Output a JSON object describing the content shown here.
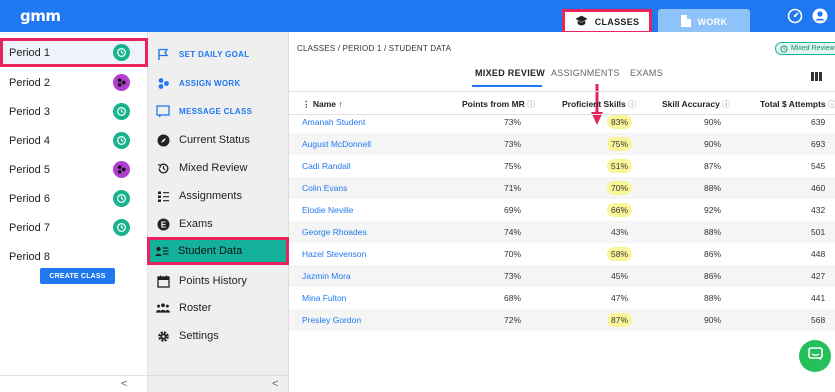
{
  "app": {
    "logo": "gmm"
  },
  "topbar": {
    "tabs": [
      {
        "label": "CLASSES",
        "icon": "graduation-cap-icon",
        "active": true
      },
      {
        "label": "WORK",
        "icon": "document-icon",
        "active": false
      }
    ],
    "icons": [
      "speedometer-icon",
      "account-circle-icon"
    ]
  },
  "periods": {
    "items": [
      {
        "label": "Period 1",
        "badge": "green",
        "active": true
      },
      {
        "label": "Period 2",
        "badge": "purple",
        "active": false
      },
      {
        "label": "Period 3",
        "badge": "green",
        "active": false
      },
      {
        "label": "Period 4",
        "badge": "green",
        "active": false
      },
      {
        "label": "Period 5",
        "badge": "purple",
        "active": false
      },
      {
        "label": "Period 6",
        "badge": "green",
        "active": false
      },
      {
        "label": "Period 7",
        "badge": "green",
        "active": false
      },
      {
        "label": "Period 8",
        "badge": null,
        "active": false
      }
    ],
    "create_button": "CREATE CLASS",
    "collapse_label": "<"
  },
  "menu": {
    "items": [
      {
        "label": "SET DAILY GOAL",
        "icon": "flag-icon",
        "type": "action"
      },
      {
        "label": "ASSIGN WORK",
        "icon": "assign-work-icon",
        "type": "action"
      },
      {
        "label": "MESSAGE CLASS",
        "icon": "message-icon",
        "type": "action"
      },
      {
        "label": "Current Status",
        "icon": "compass-icon",
        "type": "nav"
      },
      {
        "label": "Mixed Review",
        "icon": "history-icon",
        "type": "nav"
      },
      {
        "label": "Assignments",
        "icon": "list-icon",
        "type": "nav"
      },
      {
        "label": "Exams",
        "icon": "exam-icon",
        "type": "nav"
      },
      {
        "label": "Student Data",
        "icon": "student-data-icon",
        "type": "nav",
        "active": true
      },
      {
        "label": "Points History",
        "icon": "calendar-icon",
        "type": "nav"
      },
      {
        "label": "Roster",
        "icon": "people-icon",
        "type": "nav"
      },
      {
        "label": "Settings",
        "icon": "gear-icon",
        "type": "nav"
      }
    ],
    "collapse_label": "<"
  },
  "main": {
    "breadcrumb": "CLASSES / PERIOD 1 / STUDENT DATA",
    "mode_badge": "Mixed Review",
    "subtabs": [
      "MIXED REVIEW",
      "ASSIGNMENTS",
      "EXAMS"
    ],
    "active_subtab": "MIXED REVIEW",
    "table": {
      "headers": [
        "Name ↑",
        "Points from MR",
        "Proficient Skills",
        "Skill Accuracy",
        "Total $ Attempts"
      ],
      "rows": [
        {
          "name": "Amanah Student",
          "points": "73%",
          "proficient": "83%",
          "highlight": true,
          "accuracy": "90%",
          "attempts": "639"
        },
        {
          "name": "August McDonnell",
          "points": "73%",
          "proficient": "75%",
          "highlight": true,
          "accuracy": "90%",
          "attempts": "693"
        },
        {
          "name": "Cadi Randall",
          "points": "75%",
          "proficient": "51%",
          "highlight": true,
          "accuracy": "87%",
          "attempts": "545"
        },
        {
          "name": "Colin Evans",
          "points": "71%",
          "proficient": "70%",
          "highlight": true,
          "accuracy": "88%",
          "attempts": "460"
        },
        {
          "name": "Elodie Neville",
          "points": "69%",
          "proficient": "66%",
          "highlight": true,
          "accuracy": "92%",
          "attempts": "432"
        },
        {
          "name": "George Rhoades",
          "points": "74%",
          "proficient": "43%",
          "highlight": false,
          "accuracy": "88%",
          "attempts": "501"
        },
        {
          "name": "Hazel Stevenson",
          "points": "70%",
          "proficient": "58%",
          "highlight": true,
          "accuracy": "86%",
          "attempts": "448"
        },
        {
          "name": "Jazmin Mora",
          "points": "73%",
          "proficient": "45%",
          "highlight": false,
          "accuracy": "86%",
          "attempts": "427"
        },
        {
          "name": "Mina Fulton",
          "points": "68%",
          "proficient": "47%",
          "highlight": false,
          "accuracy": "88%",
          "attempts": "441"
        },
        {
          "name": "Presley Gordon",
          "points": "72%",
          "proficient": "87%",
          "highlight": true,
          "accuracy": "90%",
          "attempts": "568"
        }
      ]
    }
  },
  "colors": {
    "brand_blue": "#1f78f0",
    "teal": "#14b29c",
    "annotation_pink": "#e8245e",
    "highlight_yellow": "#fbf59a",
    "badge_green": "#17b28f",
    "badge_purple": "#b23ed1"
  }
}
